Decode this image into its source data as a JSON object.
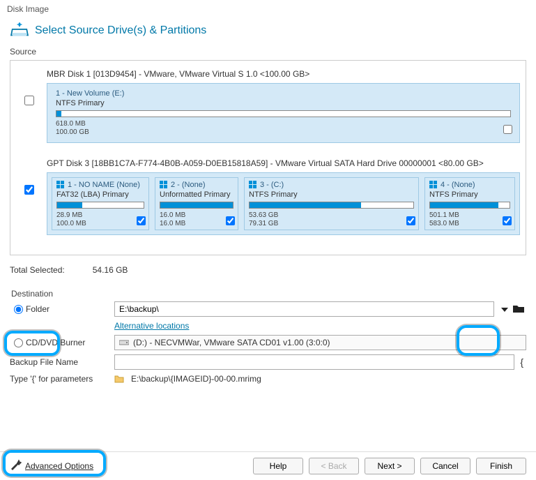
{
  "window_title": "Disk Image",
  "header_title": "Select Source Drive(s) & Partitions",
  "source_label": "Source",
  "disks": [
    {
      "title": "MBR Disk 1 [013D9454] - VMware,  VMware Virtual S 1.0  <100.00 GB>",
      "checked": false,
      "partitions": [
        {
          "head": "1 - New Volume (E:)",
          "type": "NTFS Primary",
          "used_pct": 1,
          "size1": "618.0 MB",
          "size2": "100.00 GB",
          "checked": false
        }
      ]
    },
    {
      "title": "GPT Disk 3 [18BB1C7A-F774-4B0B-A059-D0EB15818A59] - VMware Virtual SATA Hard Drive 00000001  <80.00 GB>",
      "checked": true,
      "partitions": [
        {
          "head": "1 - NO NAME (None)",
          "type": "FAT32 (LBA) Primary",
          "used_pct": 29,
          "size1": "28.9 MB",
          "size2": "100.0 MB",
          "checked": true
        },
        {
          "head": "2 -  (None)",
          "type": "Unformatted Primary",
          "used_pct": 100,
          "size1": "16.0 MB",
          "size2": "16.0 MB",
          "checked": true
        },
        {
          "head": "3 -  (C:)",
          "type": "NTFS Primary",
          "used_pct": 68,
          "size1": "53.63 GB",
          "size2": "79.31 GB",
          "checked": true
        },
        {
          "head": "4 -  (None)",
          "type": "NTFS Primary",
          "used_pct": 86,
          "size1": "501.1 MB",
          "size2": "583.0 MB",
          "checked": true
        }
      ]
    }
  ],
  "total_label": "Total Selected:",
  "total_value": "54.16 GB",
  "destination": {
    "label": "Destination",
    "folder_label": "Folder",
    "folder_path": "E:\\backup\\",
    "alt_locations": "Alternative locations",
    "cd_label": "CD/DVD Burner",
    "cd_value": "(D:) - NECVMWar, VMware SATA CD01 v1.00 (3:0:0)",
    "filename_label": "Backup File Name",
    "filename_value": "",
    "params_label": "Type '{' for parameters",
    "params_path": "E:\\backup\\{IMAGEID}-00-00.mrimg",
    "brace": "{"
  },
  "advanced": "Advanced Options",
  "buttons": {
    "help": "Help",
    "back": "< Back",
    "next": "Next >",
    "cancel": "Cancel",
    "finish": "Finish"
  }
}
